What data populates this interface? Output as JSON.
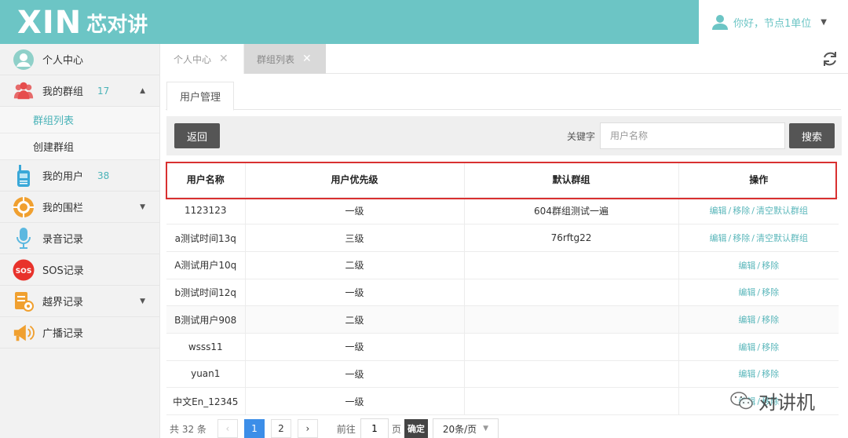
{
  "header": {
    "logo_text": "XIN",
    "brand_text": "芯对讲",
    "user_greeting": "你好，节点1单位",
    "colors": {
      "header_bg": "#6cc5c5",
      "accent": "#4ab3b8"
    }
  },
  "sidebar": {
    "items": [
      {
        "label": "个人中心",
        "icon": "user-avatar-icon"
      },
      {
        "label": "我的群组",
        "icon": "group-icon",
        "count": "17",
        "expanded": true
      },
      {
        "label": "群组列表",
        "sub": true,
        "active": true
      },
      {
        "label": "创建群组",
        "sub": true
      },
      {
        "label": "我的用户",
        "icon": "walkie-talkie-icon",
        "count": "38"
      },
      {
        "label": "我的围栏",
        "icon": "fence-target-icon"
      },
      {
        "label": "录音记录",
        "icon": "microphone-icon"
      },
      {
        "label": "SOS记录",
        "icon": "sos-icon"
      },
      {
        "label": "越界记录",
        "icon": "boundary-icon"
      },
      {
        "label": "广播记录",
        "icon": "megaphone-icon"
      }
    ]
  },
  "tabs": [
    {
      "label": "个人中心"
    },
    {
      "label": "群组列表",
      "active": true
    }
  ],
  "inner_tab": {
    "label": "用户管理"
  },
  "toolbar": {
    "back_label": "返回",
    "keyword_label": "关键字",
    "keyword_placeholder": "用户名称",
    "search_label": "搜索"
  },
  "table": {
    "headers": [
      "用户名称",
      "用户优先级",
      "默认群组",
      "操作"
    ],
    "rows": [
      {
        "name": "1123123",
        "priority": "一级",
        "group": "604群组测试一遍",
        "ops": [
          "编辑",
          "移除",
          "清空默认群组"
        ]
      },
      {
        "name": "a测试时间13q",
        "priority": "三级",
        "group": "76rftg22",
        "ops": [
          "编辑",
          "移除",
          "清空默认群组"
        ]
      },
      {
        "name": "A测试用户10q",
        "priority": "二级",
        "group": "",
        "ops": [
          "编辑",
          "移除"
        ]
      },
      {
        "name": "b测试时间12q",
        "priority": "一级",
        "group": "",
        "ops": [
          "编辑",
          "移除"
        ]
      },
      {
        "name": "B测试用户908",
        "priority": "二级",
        "group": "",
        "ops": [
          "编辑",
          "移除"
        ]
      },
      {
        "name": "wsss11",
        "priority": "一级",
        "group": "",
        "ops": [
          "编辑",
          "移除"
        ]
      },
      {
        "name": "yuan1",
        "priority": "一级",
        "group": "",
        "ops": [
          "编辑",
          "移除"
        ]
      },
      {
        "name": "中文En_12345",
        "priority": "一级",
        "group": "",
        "ops": [
          "编辑",
          "移除"
        ]
      }
    ]
  },
  "pager": {
    "total": "共 32 条",
    "pages": [
      "1",
      "2"
    ],
    "current": "1",
    "goto_label": "前往",
    "goto_value": "1",
    "page_unit": "页",
    "ok_label": "确定",
    "size_label": "20条/页"
  },
  "watermark": {
    "text": "对讲机"
  }
}
